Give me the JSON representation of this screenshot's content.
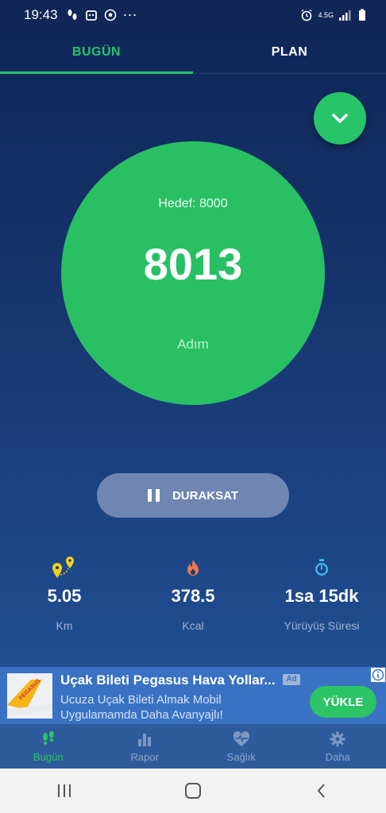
{
  "status_bar": {
    "time": "19:43",
    "more": "⋯",
    "network": "4.5G"
  },
  "tabs": [
    {
      "label": "BUGÜN",
      "active": true
    },
    {
      "label": "PLAN",
      "active": false
    }
  ],
  "fab": {
    "icon": "chevron-down-icon"
  },
  "progress": {
    "goal_text": "Hedef: 8000",
    "steps": "8013",
    "unit": "Adım"
  },
  "pause_button": {
    "label": "DURAKSAT",
    "icon": "pause-icon"
  },
  "stats": [
    {
      "icon": "location-pins-icon",
      "value": "5.05",
      "label": "Km",
      "color": "#f2d21a"
    },
    {
      "icon": "flame-icon",
      "value": "378.5",
      "label": "Kcal",
      "color": "#f07a4a"
    },
    {
      "icon": "stopwatch-icon",
      "value": "1sa 15dk",
      "label": "Yürüyüş Süresi",
      "color": "#3fb4f0"
    }
  ],
  "ad": {
    "title": "Uçak Bileti Pegasus Hava Yollar...",
    "badge": "Ad",
    "description_line1": "Ucuza Uçak Bileti Almak Mobil",
    "description_line2": "Uygulamamda Daha Avanyajlı!",
    "button": "YÜKLE",
    "image_text": "PEGASUS"
  },
  "bottom_nav": [
    {
      "label": "Bugün",
      "icon": "footsteps-icon",
      "active": true
    },
    {
      "label": "Rapor",
      "icon": "bar-chart-icon",
      "active": false
    },
    {
      "label": "Sağlık",
      "icon": "heart-pulse-icon",
      "active": false
    },
    {
      "label": "Daha",
      "icon": "gear-icon",
      "active": false
    }
  ],
  "system_nav": [
    "recent-apps",
    "home",
    "back"
  ],
  "colors": {
    "accent": "#27c46a",
    "background_top": "#0f2656",
    "background_bottom": "#2a5ca0",
    "pause_button": "#6f86b2",
    "ad_background": "#3a72c3"
  }
}
